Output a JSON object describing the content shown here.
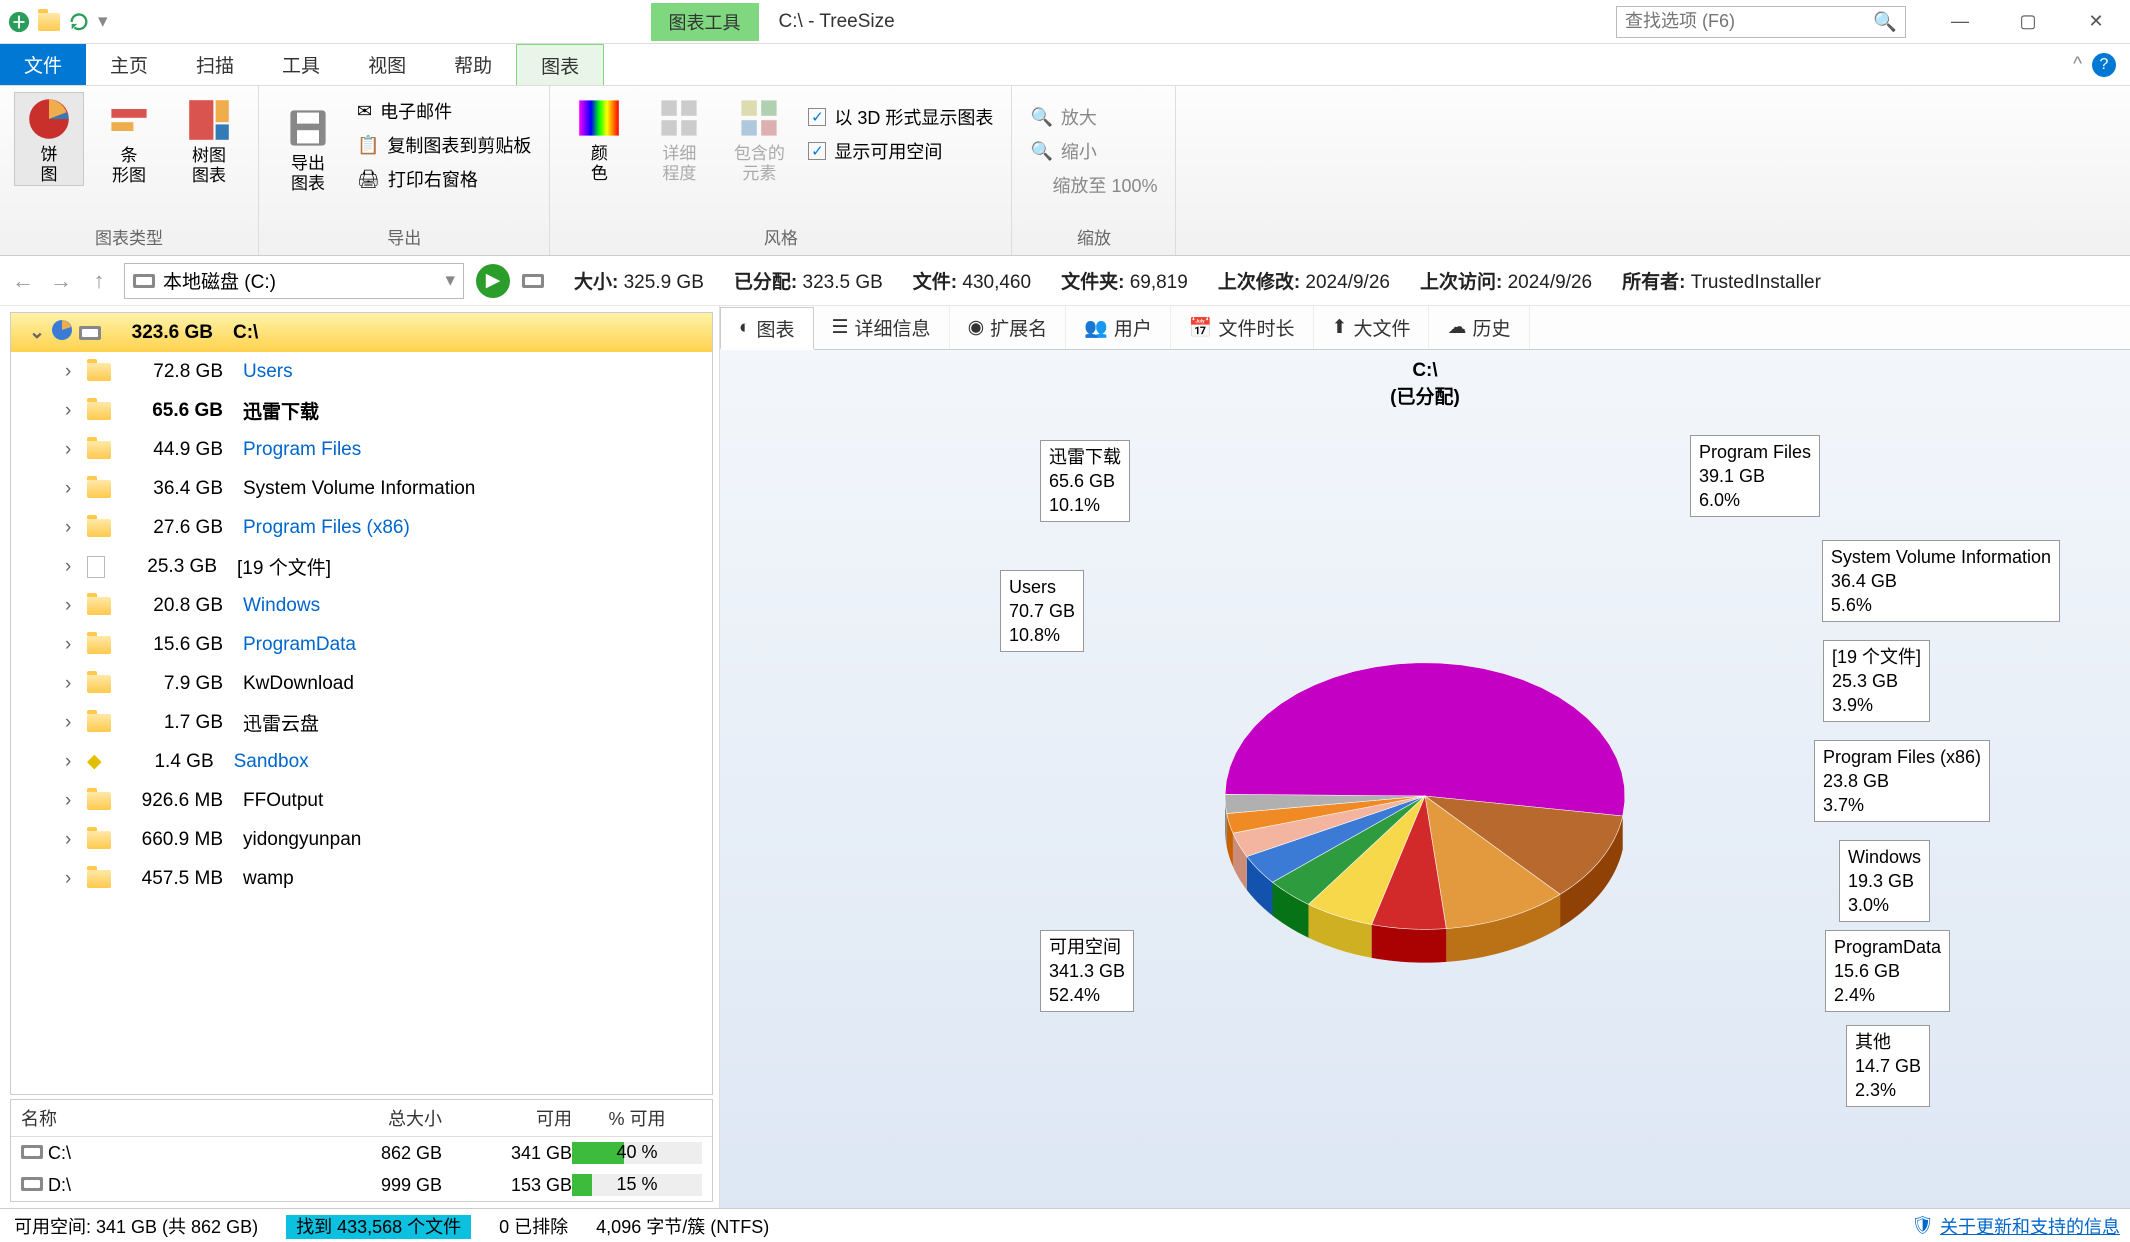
{
  "window": {
    "title": "C:\\ - TreeSize",
    "search_placeholder": "查找选项 (F6)",
    "chart_tools": "图表工具"
  },
  "menu": {
    "file": "文件",
    "home": "主页",
    "scan": "扫描",
    "tools": "工具",
    "view": "视图",
    "help": "帮助",
    "chart": "图表"
  },
  "ribbon": {
    "g_chart_types": "图表类型",
    "btn_pie": "饼\n图",
    "btn_bar": "条\n形图",
    "btn_treemap": "树图\n图表",
    "g_export": "导出",
    "btn_export_chart": "导出\n图表",
    "btn_email": "电子邮件",
    "btn_copy_clip": "复制图表到剪贴板",
    "btn_print_right": "打印右窗格",
    "g_style": "风格",
    "btn_color": "颜\n色",
    "btn_detail_level": "详细\n程度",
    "btn_incl_elem": "包含的\n元素",
    "chk_3d": "以 3D 形式显示图表",
    "chk_freespace": "显示可用空间",
    "g_zoom": "缩放",
    "btn_zoom_in": "放大",
    "btn_zoom_out": "缩小",
    "zoom_100": "缩放至 100%"
  },
  "loc": {
    "drive_label": "本地磁盘 (C:)",
    "size_k": "大小:",
    "size_v": "325.9 GB",
    "alloc_k": "已分配:",
    "alloc_v": "323.5 GB",
    "files_k": "文件:",
    "files_v": "430,460",
    "folders_k": "文件夹:",
    "folders_v": "69,819",
    "mod_k": "上次修改:",
    "mod_v": "2024/9/26",
    "acc_k": "上次访问:",
    "acc_v": "2024/9/26",
    "owner_k": "所有者:",
    "owner_v": "TrustedInstaller"
  },
  "tree": {
    "root": {
      "size": "323.6 GB",
      "name": "C:\\"
    },
    "items": [
      {
        "size": "72.8 GB",
        "name": "Users",
        "blue": true
      },
      {
        "size": "65.6 GB",
        "name": "迅雷下载",
        "blue": false,
        "bold": true
      },
      {
        "size": "44.9 GB",
        "name": "Program Files",
        "blue": true
      },
      {
        "size": "36.4 GB",
        "name": "System Volume Information",
        "blue": false
      },
      {
        "size": "27.6 GB",
        "name": "Program Files (x86)",
        "blue": true
      },
      {
        "size": "25.3 GB",
        "name": "[19 个文件]",
        "blue": false,
        "file": true
      },
      {
        "size": "20.8 GB",
        "name": "Windows",
        "blue": true
      },
      {
        "size": "15.6 GB",
        "name": "ProgramData",
        "blue": true
      },
      {
        "size": "7.9 GB",
        "name": "KwDownload",
        "blue": false
      },
      {
        "size": "1.7 GB",
        "name": "迅雷云盘",
        "blue": false
      },
      {
        "size": "1.4 GB",
        "name": "Sandbox",
        "blue": true,
        "sand": true
      },
      {
        "size": "926.6 MB",
        "name": "FFOutput",
        "blue": false
      },
      {
        "size": "660.9 MB",
        "name": "yidongyunpan",
        "blue": false
      },
      {
        "size": "457.5 MB",
        "name": "wamp",
        "blue": false
      }
    ]
  },
  "drives": {
    "h_name": "名称",
    "h_total": "总大小",
    "h_free": "可用",
    "h_pct": "% 可用",
    "rows": [
      {
        "name": "C:\\",
        "total": "862 GB",
        "free": "341 GB",
        "pct": "40 %",
        "fill": 40
      },
      {
        "name": "D:\\",
        "total": "999 GB",
        "free": "153 GB",
        "pct": "15 %",
        "fill": 15
      }
    ]
  },
  "dtabs": {
    "chart": "图表",
    "details": "详细信息",
    "ext": "扩展名",
    "users": "用户",
    "filetime": "文件时长",
    "bigfiles": "大文件",
    "history": "历史"
  },
  "chart_title": {
    "line1": "C:\\",
    "line2": "(已分配)"
  },
  "callouts": {
    "xl": {
      "l1": "迅雷下载",
      "l2": "65.6 GB",
      "l3": "10.1%"
    },
    "users": {
      "l1": "Users",
      "l2": "70.7 GB",
      "l3": "10.8%"
    },
    "free": {
      "l1": "可用空间",
      "l2": "341.3 GB",
      "l3": "52.4%"
    },
    "pf": {
      "l1": "Program Files",
      "l2": "39.1 GB",
      "l3": "6.0%"
    },
    "svi": {
      "l1": "System Volume Information",
      "l2": "36.4 GB",
      "l3": "5.6%"
    },
    "f19": {
      "l1": "[19 个文件]",
      "l2": "25.3 GB",
      "l3": "3.9%"
    },
    "pf86": {
      "l1": "Program Files (x86)",
      "l2": "23.8 GB",
      "l3": "3.7%"
    },
    "win": {
      "l1": "Windows",
      "l2": "19.3 GB",
      "l3": "3.0%"
    },
    "pd": {
      "l1": "ProgramData",
      "l2": "15.6 GB",
      "l3": "2.4%"
    },
    "other": {
      "l1": "其他",
      "l2": "14.7 GB",
      "l3": "2.3%"
    }
  },
  "chart_data": {
    "type": "pie",
    "title": "C:\\ (已分配)",
    "series": [
      {
        "name": "可用空间",
        "value_gb": 341.3,
        "percent": 52.4,
        "color": "#c400c4"
      },
      {
        "name": "Users",
        "value_gb": 70.7,
        "percent": 10.8,
        "color": "#b86a2e"
      },
      {
        "name": "迅雷下载",
        "value_gb": 65.6,
        "percent": 10.1,
        "color": "#e39a3e"
      },
      {
        "name": "Program Files",
        "value_gb": 39.1,
        "percent": 6.0,
        "color": "#d22a2a"
      },
      {
        "name": "System Volume Information",
        "value_gb": 36.4,
        "percent": 5.6,
        "color": "#f7d84a"
      },
      {
        "name": "[19 个文件]",
        "value_gb": 25.3,
        "percent": 3.9,
        "color": "#2e9b3e"
      },
      {
        "name": "Program Files (x86)",
        "value_gb": 23.8,
        "percent": 3.7,
        "color": "#3b7bd6"
      },
      {
        "name": "Windows",
        "value_gb": 19.3,
        "percent": 3.0,
        "color": "#f4b5a0"
      },
      {
        "name": "ProgramData",
        "value_gb": 15.6,
        "percent": 2.4,
        "color": "#f08a24"
      },
      {
        "name": "其他",
        "value_gb": 14.7,
        "percent": 2.3,
        "color": "#b0b0b0"
      }
    ]
  },
  "status": {
    "freespace": "可用空间: 341 GB  (共 862 GB)",
    "found": "找到 433,568 个文件",
    "excluded": "0 已排除",
    "cluster": "4,096 字节/簇 (NTFS)",
    "support": "关于更新和支持的信息"
  }
}
